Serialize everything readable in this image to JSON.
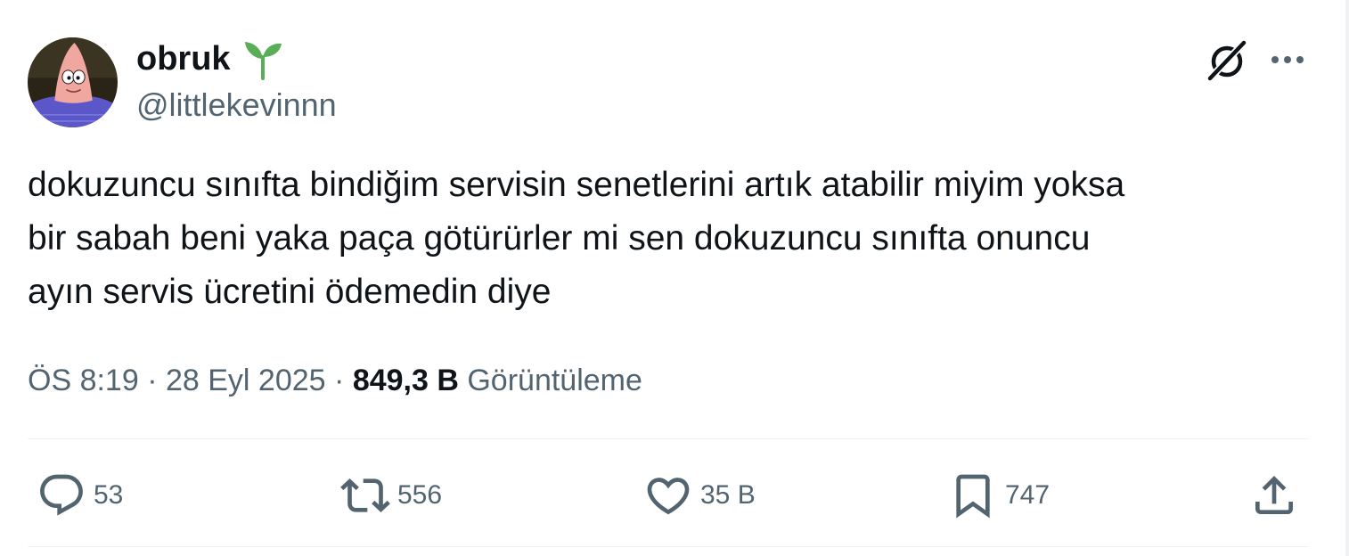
{
  "author": {
    "display_name": "obruk",
    "handle": "@littlekevinnn",
    "badge_icon": "sprout-icon"
  },
  "header_icons": [
    "grok-icon",
    "more-icon"
  ],
  "tweet": {
    "text": "dokuzuncu sınıfta bindiğim servisin senetlerini artık atabilir miyim yoksa\nbir sabah beni yaka paça götürürler mi sen dokuzuncu sınıfta onuncu\nayın servis ücretini ödemedin diye"
  },
  "meta": {
    "time": "ÖS 8:19",
    "separator1": "·",
    "date": "28 Eyl 2025",
    "separator2": "·",
    "views_count": "849,3 B",
    "views_label": "Görüntüleme"
  },
  "actions": {
    "replies": "53",
    "reposts": "556",
    "likes": "35 B",
    "bookmarks": "747"
  },
  "colors": {
    "text": "#0f1419",
    "secondary": "#536471",
    "divider": "#eff3f4",
    "sprout": "#5aae57"
  }
}
